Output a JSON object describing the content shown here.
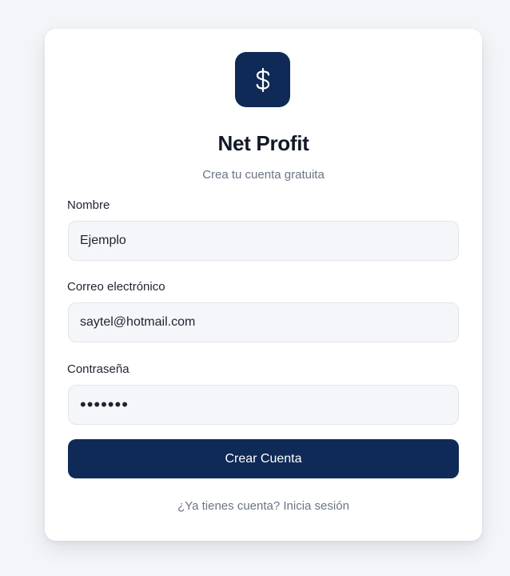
{
  "brand": {
    "icon": "dollar-sign-icon",
    "icon_glyph": "$",
    "title": "Net Profit",
    "subtitle": "Crea tu cuenta gratuita",
    "accent_color": "#0f2a56"
  },
  "form": {
    "name": {
      "label": "Nombre",
      "value": "Ejemplo"
    },
    "email": {
      "label": "Correo electrónico",
      "value": "saytel@hotmail.com"
    },
    "password": {
      "label": "Contraseña",
      "value": "•••••••"
    },
    "submit_label": "Crear Cuenta"
  },
  "footer": {
    "login_link": "¿Ya tienes cuenta? Inicia sesión"
  }
}
